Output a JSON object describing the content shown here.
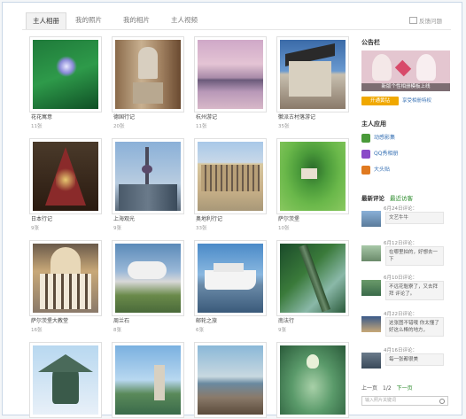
{
  "tabs": [
    "主人相册",
    "我的照片",
    "我的相片",
    "主人视频"
  ],
  "feedback_label": "反馈问题",
  "albums": [
    {
      "name": "花花寓意",
      "count": "11张"
    },
    {
      "name": "德国行记",
      "count": "20张"
    },
    {
      "name": "杭州游记",
      "count": "11张"
    },
    {
      "name": "徽派古村落游记",
      "count": "35张"
    },
    {
      "name": "日本行记",
      "count": "9张"
    },
    {
      "name": "上海观光",
      "count": "9张"
    },
    {
      "name": "奥地利行记",
      "count": "33张"
    },
    {
      "name": "萨尔茨堡",
      "count": "10张"
    },
    {
      "name": "萨尔茨堡大教堂",
      "count": "16张"
    },
    {
      "name": "周兰石",
      "count": "8张"
    },
    {
      "name": "邮轮之旅",
      "count": "6张"
    },
    {
      "name": "南法行",
      "count": "9张"
    },
    {
      "name": "",
      "count": ""
    },
    {
      "name": "",
      "count": ""
    },
    {
      "name": "",
      "count": ""
    },
    {
      "name": "",
      "count": ""
    }
  ],
  "sidebar": {
    "announcement_title": "公告栏",
    "banner_caption": "新版个性相册模板上线",
    "open_button": "开通黄钻",
    "privilege_link": "享受相册特权",
    "apps_title": "主人应用",
    "apps": [
      {
        "label": "动感影集",
        "color": "#4a9a3a"
      },
      {
        "label": "QQ秀相册",
        "color": "#8a4ac8"
      },
      {
        "label": "大头贴",
        "color": "#e07a20"
      }
    ],
    "comments_tab": "最新评论",
    "messages_tab": "最近访客",
    "comments": [
      {
        "date": "6月24日评论：",
        "text": "文艺牛牛"
      },
      {
        "date": "6月12日评论：",
        "text": "在哪里拍的，好想去一下"
      },
      {
        "date": "6月10日评论：",
        "text": "不远花魁寮了，又去拜拜 评论了。"
      },
      {
        "date": "4月22日评论：",
        "text": "这张图不错哦 你太懂了好这么棒的地方，"
      },
      {
        "date": "4月16日评论：",
        "text": "每一张都很美"
      }
    ],
    "pager_prev": "上一页",
    "pager_num": "1/2",
    "pager_next": "下一页",
    "search_placeholder": "输入照片关键词"
  }
}
